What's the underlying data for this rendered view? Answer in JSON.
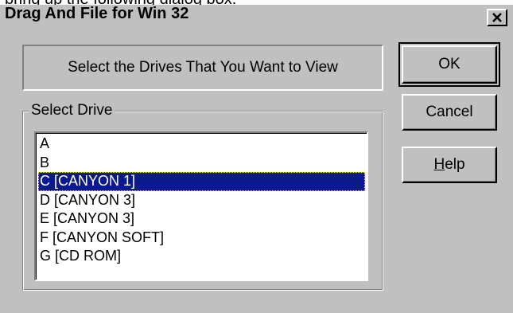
{
  "background_caption": "bring up the following dialog box:",
  "dialog": {
    "title": "Drag And File for Win 32",
    "close_glyph": "✕",
    "prompt": "Select the Drives That You Want to View",
    "group_label": "Select Drive",
    "drives": [
      {
        "label": "A",
        "selected": false
      },
      {
        "label": "B",
        "selected": false
      },
      {
        "label": "C [CANYON 1]",
        "selected": true
      },
      {
        "label": "D [CANYON 3]",
        "selected": false
      },
      {
        "label": "E [CANYON 3]",
        "selected": false
      },
      {
        "label": "F [CANYON SOFT]",
        "selected": false
      },
      {
        "label": "G [CD ROM]",
        "selected": false
      }
    ],
    "buttons": {
      "ok": "OK",
      "cancel": "Cancel",
      "help_prefix": "H",
      "help_rest": "elp"
    }
  },
  "colors": {
    "dialog_face": "#c0c0c0",
    "selection": "#0a1a8c"
  }
}
